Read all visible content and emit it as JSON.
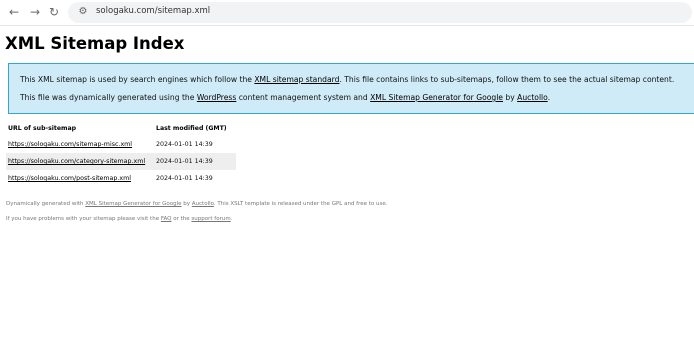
{
  "browser": {
    "back_icon": "←",
    "forward_icon": "→",
    "reload_icon": "↻",
    "site_settings_icon": "⚙",
    "url": "sologaku.com/sitemap.xml"
  },
  "page": {
    "title": "XML Sitemap Index",
    "intro": {
      "line1_before": "This XML sitemap is used by search engines which follow the ",
      "line1_link": "XML sitemap standard",
      "line1_after": ". This file contains links to sub-sitemaps, follow them to see the actual sitemap content.",
      "line2_before": "This file was dynamically generated using the ",
      "line2_link1": "WordPress",
      "line2_mid": " content management system and ",
      "line2_link2": "XML Sitemap Generator for Google",
      "line2_by": " by ",
      "line2_link3": "Auctollo",
      "line2_end": "."
    },
    "table": {
      "headers": [
        "URL of sub-sitemap",
        "Last modified (GMT)"
      ],
      "rows": [
        {
          "url": "https://sologaku.com/sitemap-misc.xml",
          "modified": "2024-01-01 14:39"
        },
        {
          "url": "https://sologaku.com/category-sitemap.xml",
          "modified": "2024-01-01 14:39"
        },
        {
          "url": "https://sologaku.com/post-sitemap.xml",
          "modified": "2024-01-01 14:39"
        }
      ]
    },
    "footer": {
      "line1_before": "Dynamically generated with ",
      "line1_link1": "XML Sitemap Generator for Google",
      "line1_by": " by ",
      "line1_link2": "Auctollo",
      "line1_after": ". This XSLT template is released under the GPL and free to use.",
      "line2_before": "If you have problems with your sitemap please visit the ",
      "line2_link1": "FAQ",
      "line2_mid": " or the ",
      "line2_link2": "support forum",
      "line2_end": "."
    }
  }
}
